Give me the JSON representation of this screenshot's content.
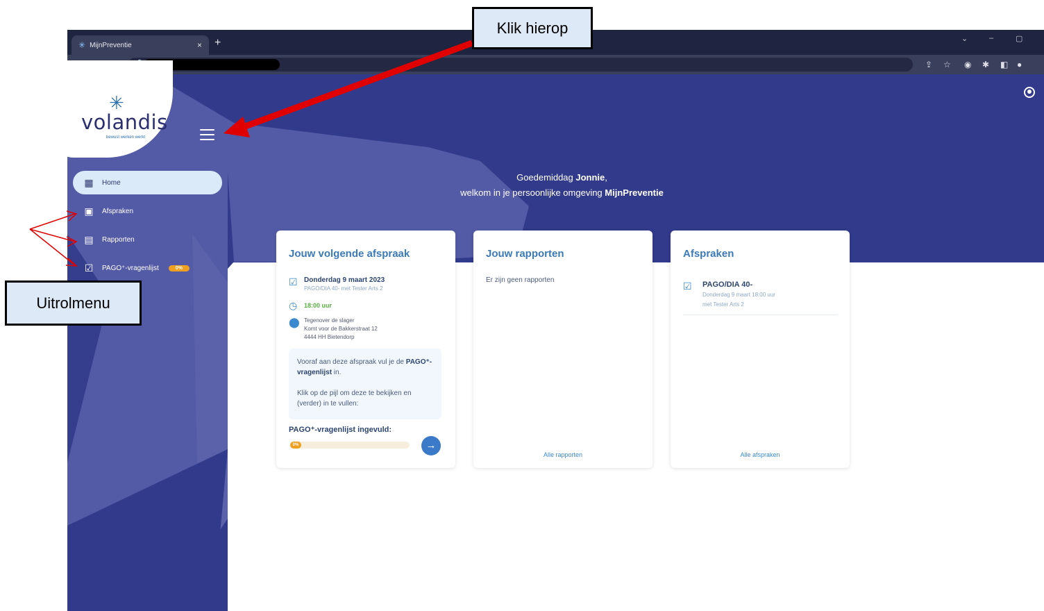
{
  "browser": {
    "tab_title": "MijnPreventie",
    "tab_close": "×",
    "new_tab": "+",
    "window_controls": [
      "⌄",
      "–",
      "▢"
    ]
  },
  "app": {
    "logo": {
      "word": "volandis",
      "tagline": "bewust werken werkt"
    },
    "greeting": {
      "prefix": "Goedemiddag ",
      "name": "Jonnie",
      "suffix": ",",
      "line2_prefix": "welkom in je persoonlijke omgeving ",
      "line2_brand": "MijnPreventie"
    },
    "nav": [
      {
        "label": "Home",
        "icon": "home-icon",
        "active": true
      },
      {
        "label": "Afspraken",
        "icon": "calendar-icon"
      },
      {
        "label": "Rapporten",
        "icon": "report-icon"
      },
      {
        "label": "PAGO⁺-vragenlijst",
        "icon": "checklist-icon",
        "badge": "0%"
      }
    ],
    "card_next": {
      "title": "Jouw volgende afspraak",
      "date": "Donderdag 9 maart 2023",
      "sub": "PAGO/DIA 40- met Tester Arts 2",
      "time": "18:00 uur",
      "location": [
        "Tegenover de slager",
        "Komt voor de Bakkerstraat 12",
        "4444 HH Bietendorp"
      ],
      "info_line1_prefix": "Vooraf aan deze afspraak vul je de ",
      "info_line1_bold": "PAGO⁺-vragenlijst",
      "info_line1_suffix": " in.",
      "info_line2": "Klik op de pijl om deze te bekijken en (verder) in te vullen:",
      "progress_label": "PAGO⁺-vragenlijst ingevuld:",
      "progress_pct": "0%",
      "progress_value": 0,
      "arrow": "→"
    },
    "card_reports": {
      "title": "Jouw rapporten",
      "empty": "Er zijn geen rapporten",
      "link": "Alle rapporten"
    },
    "card_appts": {
      "title": "Afspraken",
      "item_title": "PAGO/DIA 40-",
      "item_sub1": "Donderdag 9 maart 18:00 uur",
      "item_sub2": "met Tester Arts 2",
      "link": "Alle afspraken"
    }
  },
  "annotations": {
    "click_here": "Klik hierop",
    "dropdown_menu": "Uitrolmenu"
  },
  "colors": {
    "brand_navy": "#323a8b",
    "accent_blue": "#3a7ab8",
    "badge_orange": "#f0a020",
    "annotation_red": "#e00000"
  }
}
